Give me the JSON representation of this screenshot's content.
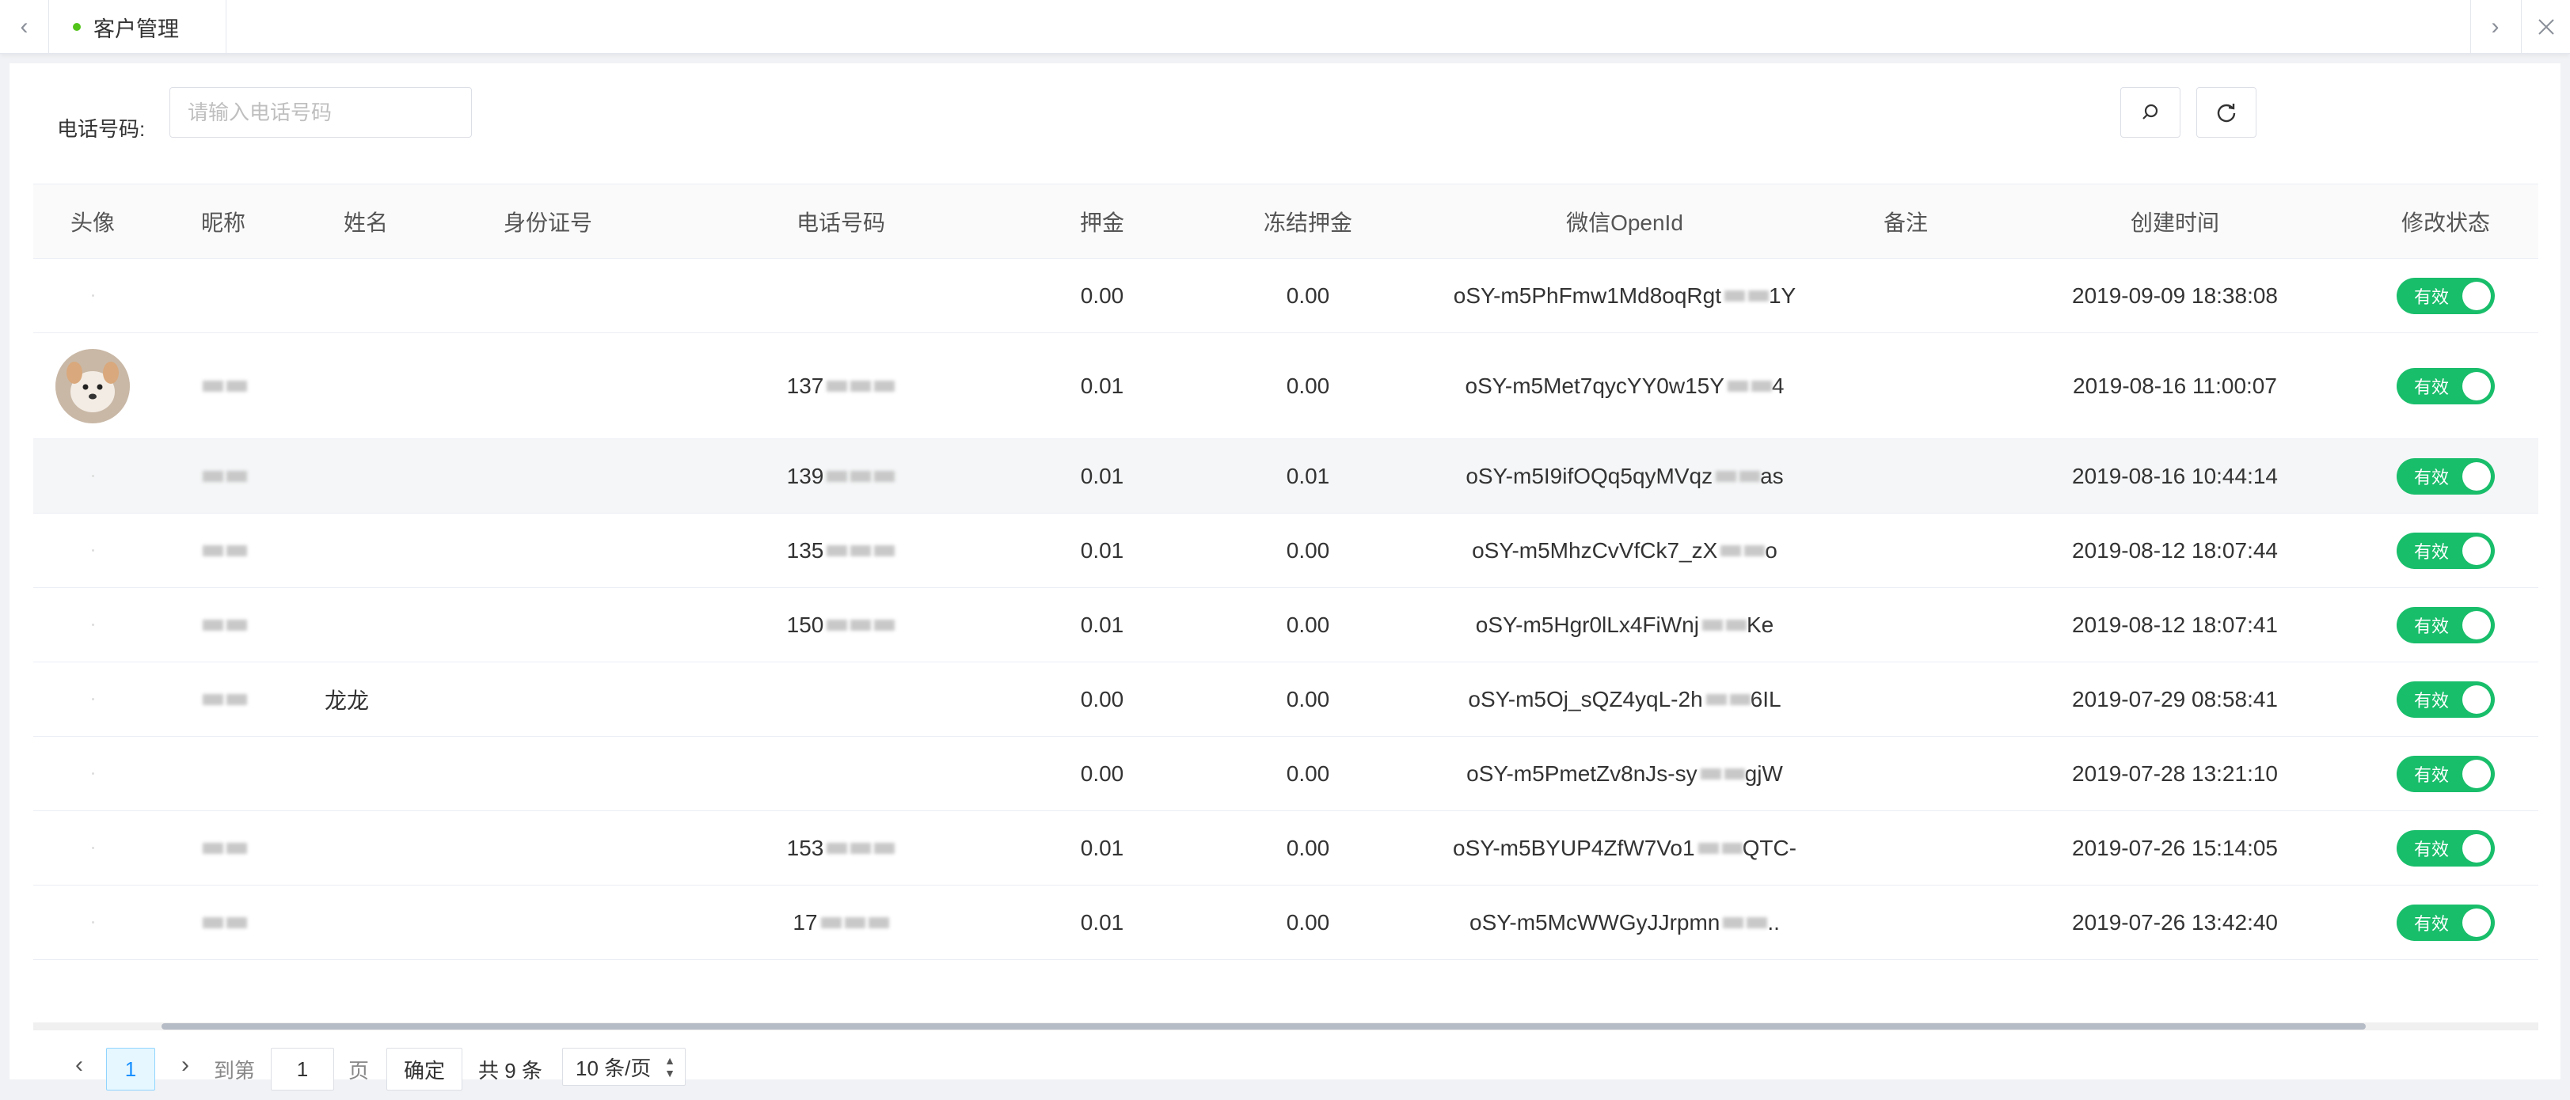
{
  "tabbar": {
    "tab_label": "客户管理",
    "active_dot_color": "#52c41a"
  },
  "search": {
    "label": "电话号码:",
    "placeholder": "请输入电话号码",
    "value": ""
  },
  "table": {
    "headers": {
      "avatar": "头像",
      "nickname": "昵称",
      "name": "姓名",
      "id_card": "身份证号",
      "phone": "电话号码",
      "deposit": "押金",
      "frozen_deposit": "冻结押金",
      "openid": "微信OpenId",
      "note": "备注",
      "created_at": "创建时间",
      "status": "修改状态"
    },
    "rows": [
      {
        "nickname": "",
        "name": "",
        "phone": "",
        "deposit": "0.00",
        "frozen": "0.00",
        "openid": "oSY-m5PhFmw1Md8oqRgt",
        "openid_tail": "1Y",
        "created": "2019-09-09 18:38:08",
        "status": "有效"
      },
      {
        "nickname": "",
        "name": "",
        "phone": "137",
        "deposit": "0.01",
        "frozen": "0.00",
        "openid": "oSY-m5Met7qycYY0w15Y",
        "openid_tail": "4",
        "created": "2019-08-16 11:00:07",
        "status": "有效"
      },
      {
        "nickname": "",
        "name": "",
        "phone": "139",
        "deposit": "0.01",
        "frozen": "0.01",
        "openid": "oSY-m5I9ifOQq5qyMVqz",
        "openid_tail": "as",
        "created": "2019-08-16 10:44:14",
        "status": "有效"
      },
      {
        "nickname": "",
        "name": "",
        "phone": "135",
        "deposit": "0.01",
        "frozen": "0.00",
        "openid": "oSY-m5MhzCvVfCk7_zX",
        "openid_tail": "o",
        "created": "2019-08-12 18:07:44",
        "status": "有效"
      },
      {
        "nickname": "",
        "name": "",
        "phone": "150",
        "deposit": "0.01",
        "frozen": "0.00",
        "openid": "oSY-m5Hgr0lLx4FiWnj",
        "openid_tail": "Ke",
        "created": "2019-08-12 18:07:41",
        "status": "有效"
      },
      {
        "nickname": "",
        "name": "龙龙",
        "phone": "",
        "deposit": "0.00",
        "frozen": "0.00",
        "openid": "oSY-m5Oj_sQZ4yqL-2h",
        "openid_tail": "6IL",
        "created": "2019-07-29 08:58:41",
        "status": "有效"
      },
      {
        "nickname": "",
        "name": "",
        "phone": "",
        "deposit": "0.00",
        "frozen": "0.00",
        "openid": "oSY-m5PmetZv8nJs-sy",
        "openid_tail": "gjW",
        "created": "2019-07-28 13:21:10",
        "status": "有效"
      },
      {
        "nickname": "",
        "name": "",
        "phone": "153",
        "deposit": "0.01",
        "frozen": "0.00",
        "openid": "oSY-m5BYUP4ZfW7Vo1",
        "openid_tail": "QTC-",
        "created": "2019-07-26 15:14:05",
        "status": "有效"
      },
      {
        "nickname": "",
        "name": "",
        "phone": "17",
        "deposit": "0.01",
        "frozen": "0.00",
        "openid": "oSY-m5McWWGyJJrpmn",
        "openid_tail": "..",
        "created": "2019-07-26 13:42:40",
        "status": "有效"
      }
    ]
  },
  "pagination": {
    "current_page": "1",
    "goto_label": "到第",
    "goto_value": "1",
    "page_unit": "页",
    "confirm": "确定",
    "total": "共 9 条",
    "page_size": "10 条/页"
  },
  "colors": {
    "toggle_on": "#19be6b",
    "page_active": "#1890ff"
  }
}
